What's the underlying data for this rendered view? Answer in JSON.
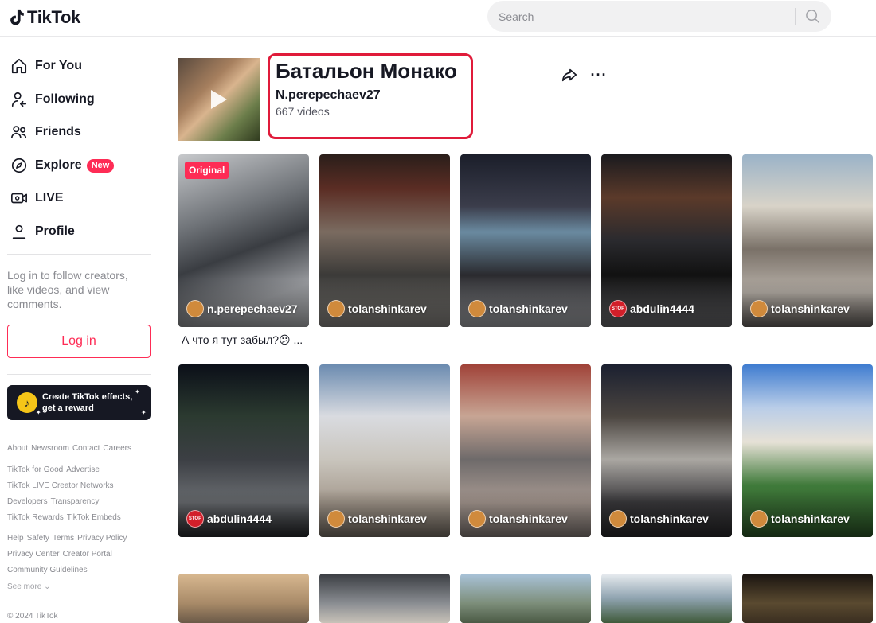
{
  "header": {
    "logo_text": "TikTok",
    "search_placeholder": "Search"
  },
  "sidebar": {
    "nav": [
      {
        "label": "For You",
        "icon": "home-icon"
      },
      {
        "label": "Following",
        "icon": "following-icon"
      },
      {
        "label": "Friends",
        "icon": "friends-icon"
      },
      {
        "label": "Explore",
        "icon": "compass-icon",
        "badge": "New"
      },
      {
        "label": "LIVE",
        "icon": "live-icon"
      },
      {
        "label": "Profile",
        "icon": "profile-icon"
      }
    ],
    "login_prompt": "Log in to follow creators, like videos, and view comments.",
    "login_button": "Log in",
    "effects_banner": "Create TikTok effects, get a reward",
    "footer": {
      "row1": [
        "About",
        "Newsroom",
        "Contact",
        "Careers"
      ],
      "row2": [
        "TikTok for Good",
        "Advertise"
      ],
      "row3": [
        "TikTok LIVE Creator Networks"
      ],
      "row4": [
        "Developers",
        "Transparency"
      ],
      "row5": [
        "TikTok Rewards",
        "TikTok Embeds"
      ],
      "row6": [
        "Help",
        "Safety",
        "Terms",
        "Privacy Policy"
      ],
      "row7": [
        "Privacy Center",
        "Creator Portal"
      ],
      "row8": [
        "Community Guidelines"
      ]
    },
    "see_more": "See more",
    "copyright": "© 2024 TikTok"
  },
  "playlist": {
    "title": "Батальон Монако",
    "author": "N.perepechaev27",
    "count": "667 videos"
  },
  "videos": [
    {
      "user": "n.perepechaev27",
      "badge": "Original",
      "caption": "А что я тут забыл?😕 ...",
      "avatar": "face"
    },
    {
      "user": "tolanshinkarev",
      "avatar": "face"
    },
    {
      "user": "tolanshinkarev",
      "avatar": "face"
    },
    {
      "user": "abdulin4444",
      "avatar": "stop"
    },
    {
      "user": "tolanshinkarev",
      "avatar": "face"
    },
    {
      "user": "abdulin4444",
      "avatar": "stop"
    },
    {
      "user": "tolanshinkarev",
      "avatar": "face"
    },
    {
      "user": "tolanshinkarev",
      "avatar": "face"
    },
    {
      "user": "tolanshinkarev",
      "avatar": "face"
    },
    {
      "user": "tolanshinkarev",
      "avatar": "face"
    }
  ],
  "avatar_stop_text": "STOP",
  "colors": {
    "accent": "#fe2c55",
    "highlight_box": "#e01b3a",
    "text_primary": "#161823",
    "text_secondary": "#8a8b91"
  }
}
